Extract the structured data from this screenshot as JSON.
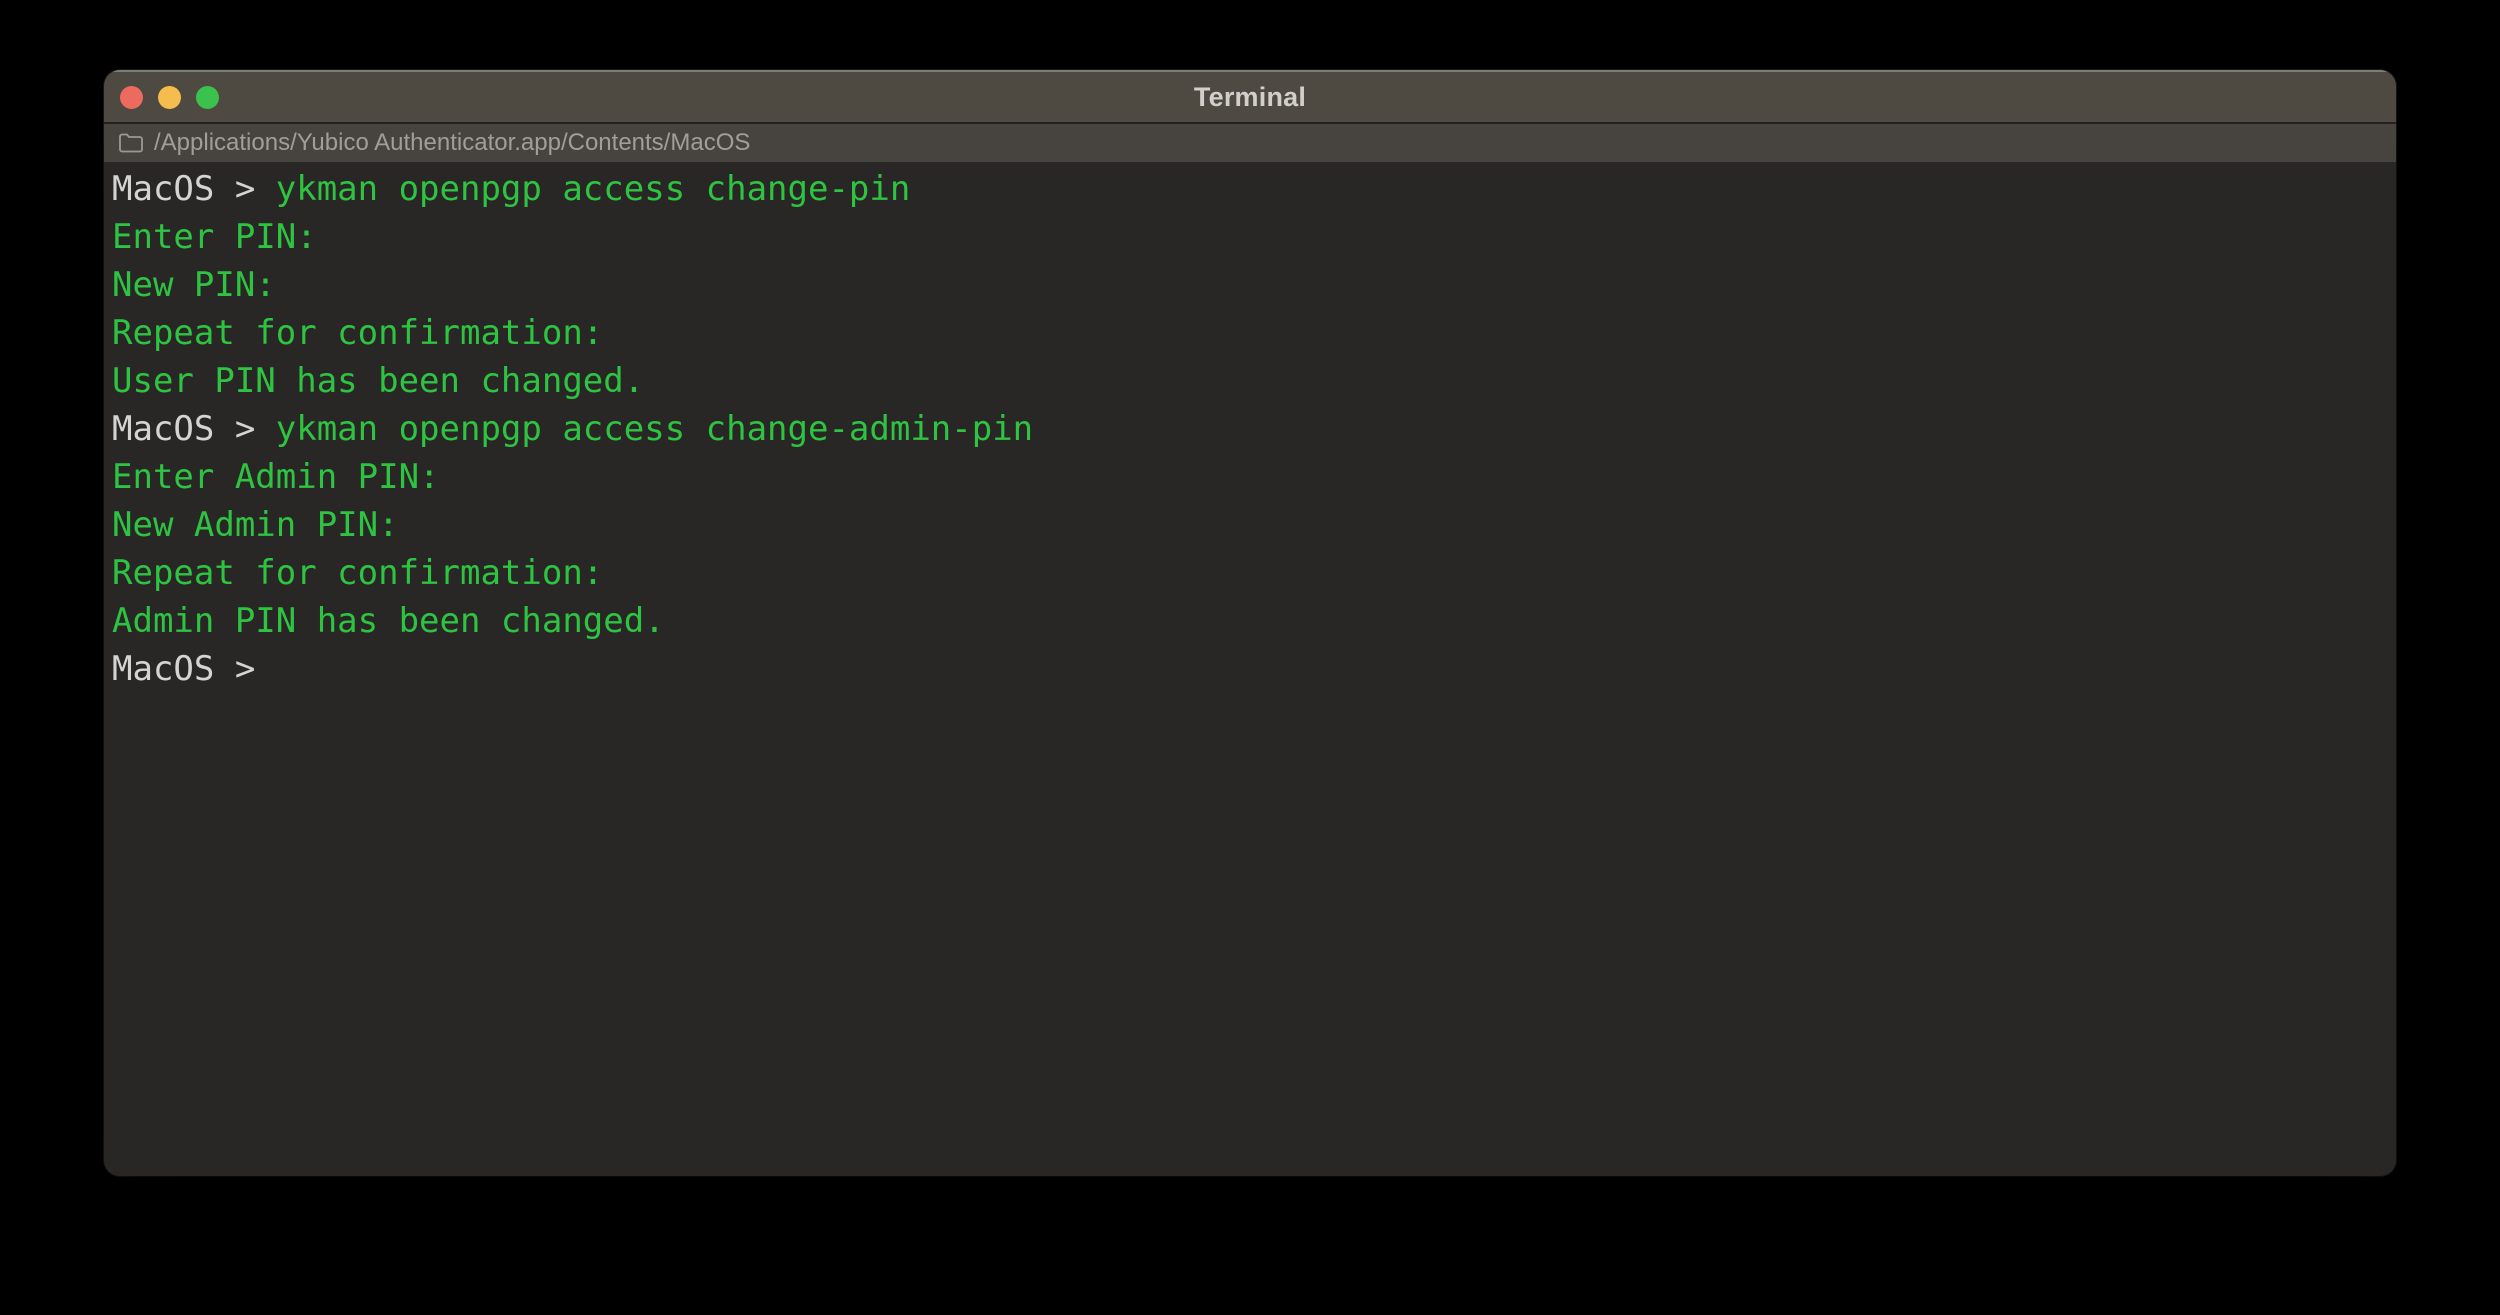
{
  "window": {
    "title": "Terminal"
  },
  "pathbar": {
    "icon": "folder-icon",
    "path": "/Applications/Yubico Authenticator.app/Contents/MacOS"
  },
  "terminal": {
    "prompt": "MacOS >",
    "lines": [
      {
        "type": "command",
        "prompt": "MacOS >",
        "command": "ykman openpgp access change-pin"
      },
      {
        "type": "output",
        "text": "Enter PIN:"
      },
      {
        "type": "output",
        "text": "New PIN:"
      },
      {
        "type": "output",
        "text": "Repeat for confirmation:"
      },
      {
        "type": "output",
        "text": "User PIN has been changed."
      },
      {
        "type": "command",
        "prompt": "MacOS >",
        "command": "ykman openpgp access change-admin-pin"
      },
      {
        "type": "output",
        "text": "Enter Admin PIN:"
      },
      {
        "type": "output",
        "text": "New Admin PIN:"
      },
      {
        "type": "output",
        "text": "Repeat for confirmation:"
      },
      {
        "type": "output",
        "text": "Admin PIN has been changed."
      },
      {
        "type": "prompt",
        "prompt": "MacOS >"
      }
    ]
  },
  "colors": {
    "outer_background": "#000000",
    "titlebar": "#4e4a42",
    "pathbar": "#474440",
    "terminal_background": "#282726",
    "prompt_text": "#d5d4d2",
    "command_green": "#2ec441",
    "path_text": "#a19e99",
    "title_text": "#d2cfcb",
    "traffic_red": "#ec6a5e",
    "traffic_yellow": "#f4bd4e",
    "traffic_green": "#3ac24d"
  }
}
